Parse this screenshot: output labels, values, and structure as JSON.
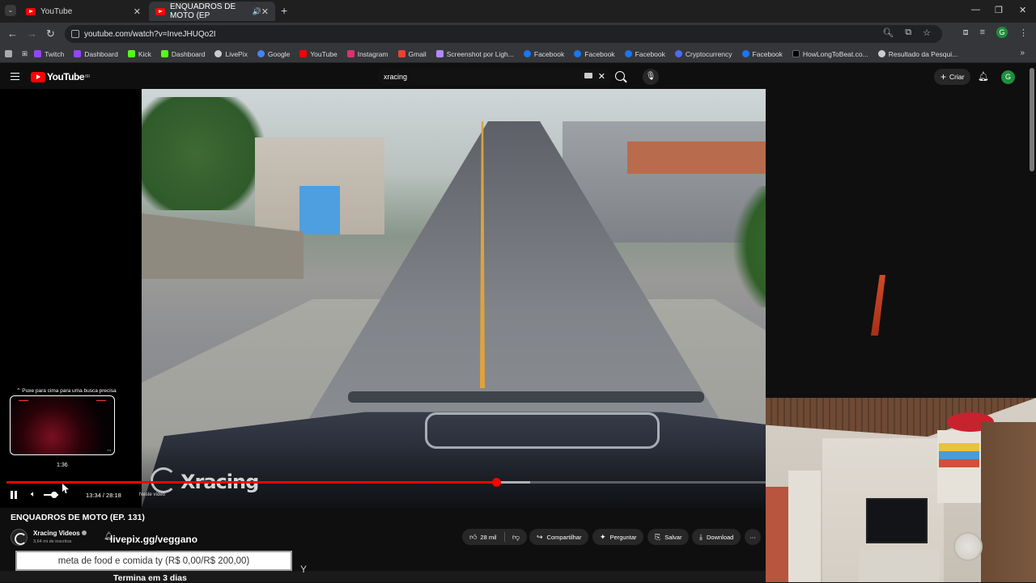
{
  "browser": {
    "tabs": [
      {
        "label": "YouTube",
        "active": false
      },
      {
        "label": "ENQUADROS DE MOTO (EP",
        "active": true
      }
    ],
    "url": "youtube.com/watch?v=InveJHUQo2I",
    "profile_initial": "G",
    "bookmarks": [
      {
        "label": "Twitch",
        "color": "#9146ff"
      },
      {
        "label": "Dashboard",
        "color": "#9146ff"
      },
      {
        "label": "Kick",
        "color": "#53fc18"
      },
      {
        "label": "Dashboard",
        "color": "#53fc18"
      },
      {
        "label": "LivePix",
        "color": "#cccccc"
      },
      {
        "label": "Google",
        "color": "#4285f4"
      },
      {
        "label": "YouTube",
        "color": "#ff0000"
      },
      {
        "label": "Instagram",
        "color": "#e1306c"
      },
      {
        "label": "Gmail",
        "color": "#ea4335"
      },
      {
        "label": "Screenshot por Ligh...",
        "color": "#b388ff"
      },
      {
        "label": "Facebook",
        "color": "#1877f2"
      },
      {
        "label": "Facebook",
        "color": "#1877f2"
      },
      {
        "label": "Facebook",
        "color": "#1877f2"
      },
      {
        "label": "Cryptocurrency",
        "color": "#4a6cf7"
      },
      {
        "label": "Facebook",
        "color": "#1877f2"
      },
      {
        "label": "HowLongToBeat.co...",
        "color": "#000000"
      },
      {
        "label": "Resultado da Pesqui...",
        "color": "#cccccc"
      }
    ]
  },
  "youtube": {
    "search_value": "xracing",
    "create_label": "Criar",
    "avatar_initial": "G"
  },
  "player": {
    "preview_hint": "Puxe para cima para uma busca precisa",
    "preview_time": "1:36",
    "time_display": "13:34 / 28:18",
    "chapter_label": "Neste vídeo",
    "watermark": "Xracing",
    "progress_played": 0.645,
    "progress_buffered": 0.69
  },
  "video": {
    "title": "ENQUADROS DE MOTO (EP. 131)",
    "channel_name": "Xracing Videos",
    "subscribers": "3,64 mi de inscritos",
    "likes": "28 mil",
    "actions": {
      "share": "Compartilhar",
      "ask": "Perguntar",
      "save": "Salvar",
      "download": "Download"
    }
  },
  "stream_overlay": {
    "donation_url": "livepix.gg/veggano",
    "goal_text": "meta de food e comida ty (R$ 0,00/R$ 200,00)",
    "ends_text": "Termina em 3 dias"
  },
  "colors": {
    "accent_red": "#ff0000",
    "background": "#0f0f0f",
    "pill": "#272727"
  }
}
